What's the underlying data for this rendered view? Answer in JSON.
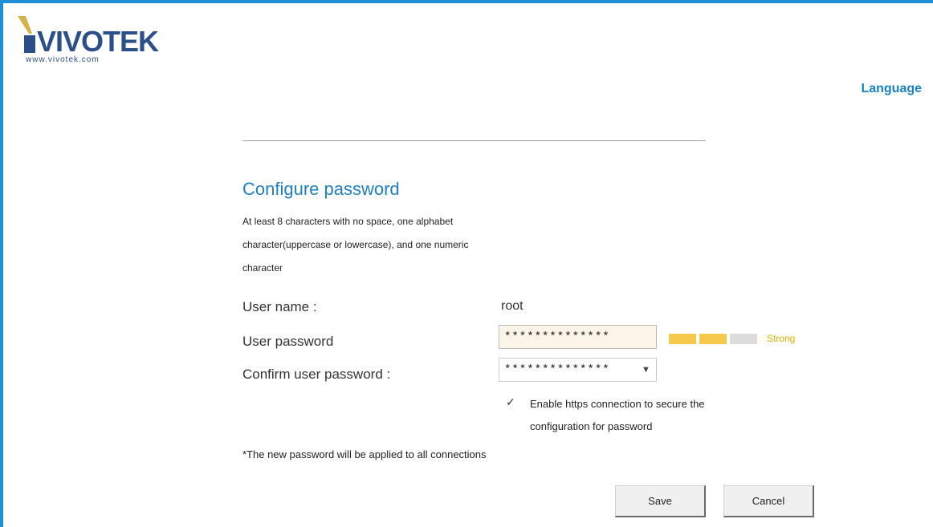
{
  "header": {
    "logo_text": "VIVOTEK",
    "logo_url_text": "www.vivotek.com",
    "language_label": "Language"
  },
  "form": {
    "title": "Configure password",
    "rules": [
      "At least 8 characters with no space, one alphabet",
      "character(uppercase or lowercase), and one numeric",
      "character"
    ],
    "username_label": "User name :",
    "username_value": "root",
    "password_label": "User password",
    "password_value": "**************",
    "confirm_label": "Confirm user password :",
    "confirm_value": "**************",
    "strength": {
      "label": "Strong",
      "bars_filled": 2,
      "bars_total": 3,
      "filled_color": "#f7c94a",
      "empty_color": "#dcdcdc"
    },
    "https_checkmark": "✓",
    "https_label_line1": "Enable https connection to secure the",
    "https_label_line2": "configuration for password",
    "https_checked": true,
    "note": "*The new password will be applied to all connections",
    "save_label": "Save",
    "cancel_label": "Cancel"
  },
  "colors": {
    "accent": "#1e8fd6",
    "title": "#1e7fc4"
  }
}
